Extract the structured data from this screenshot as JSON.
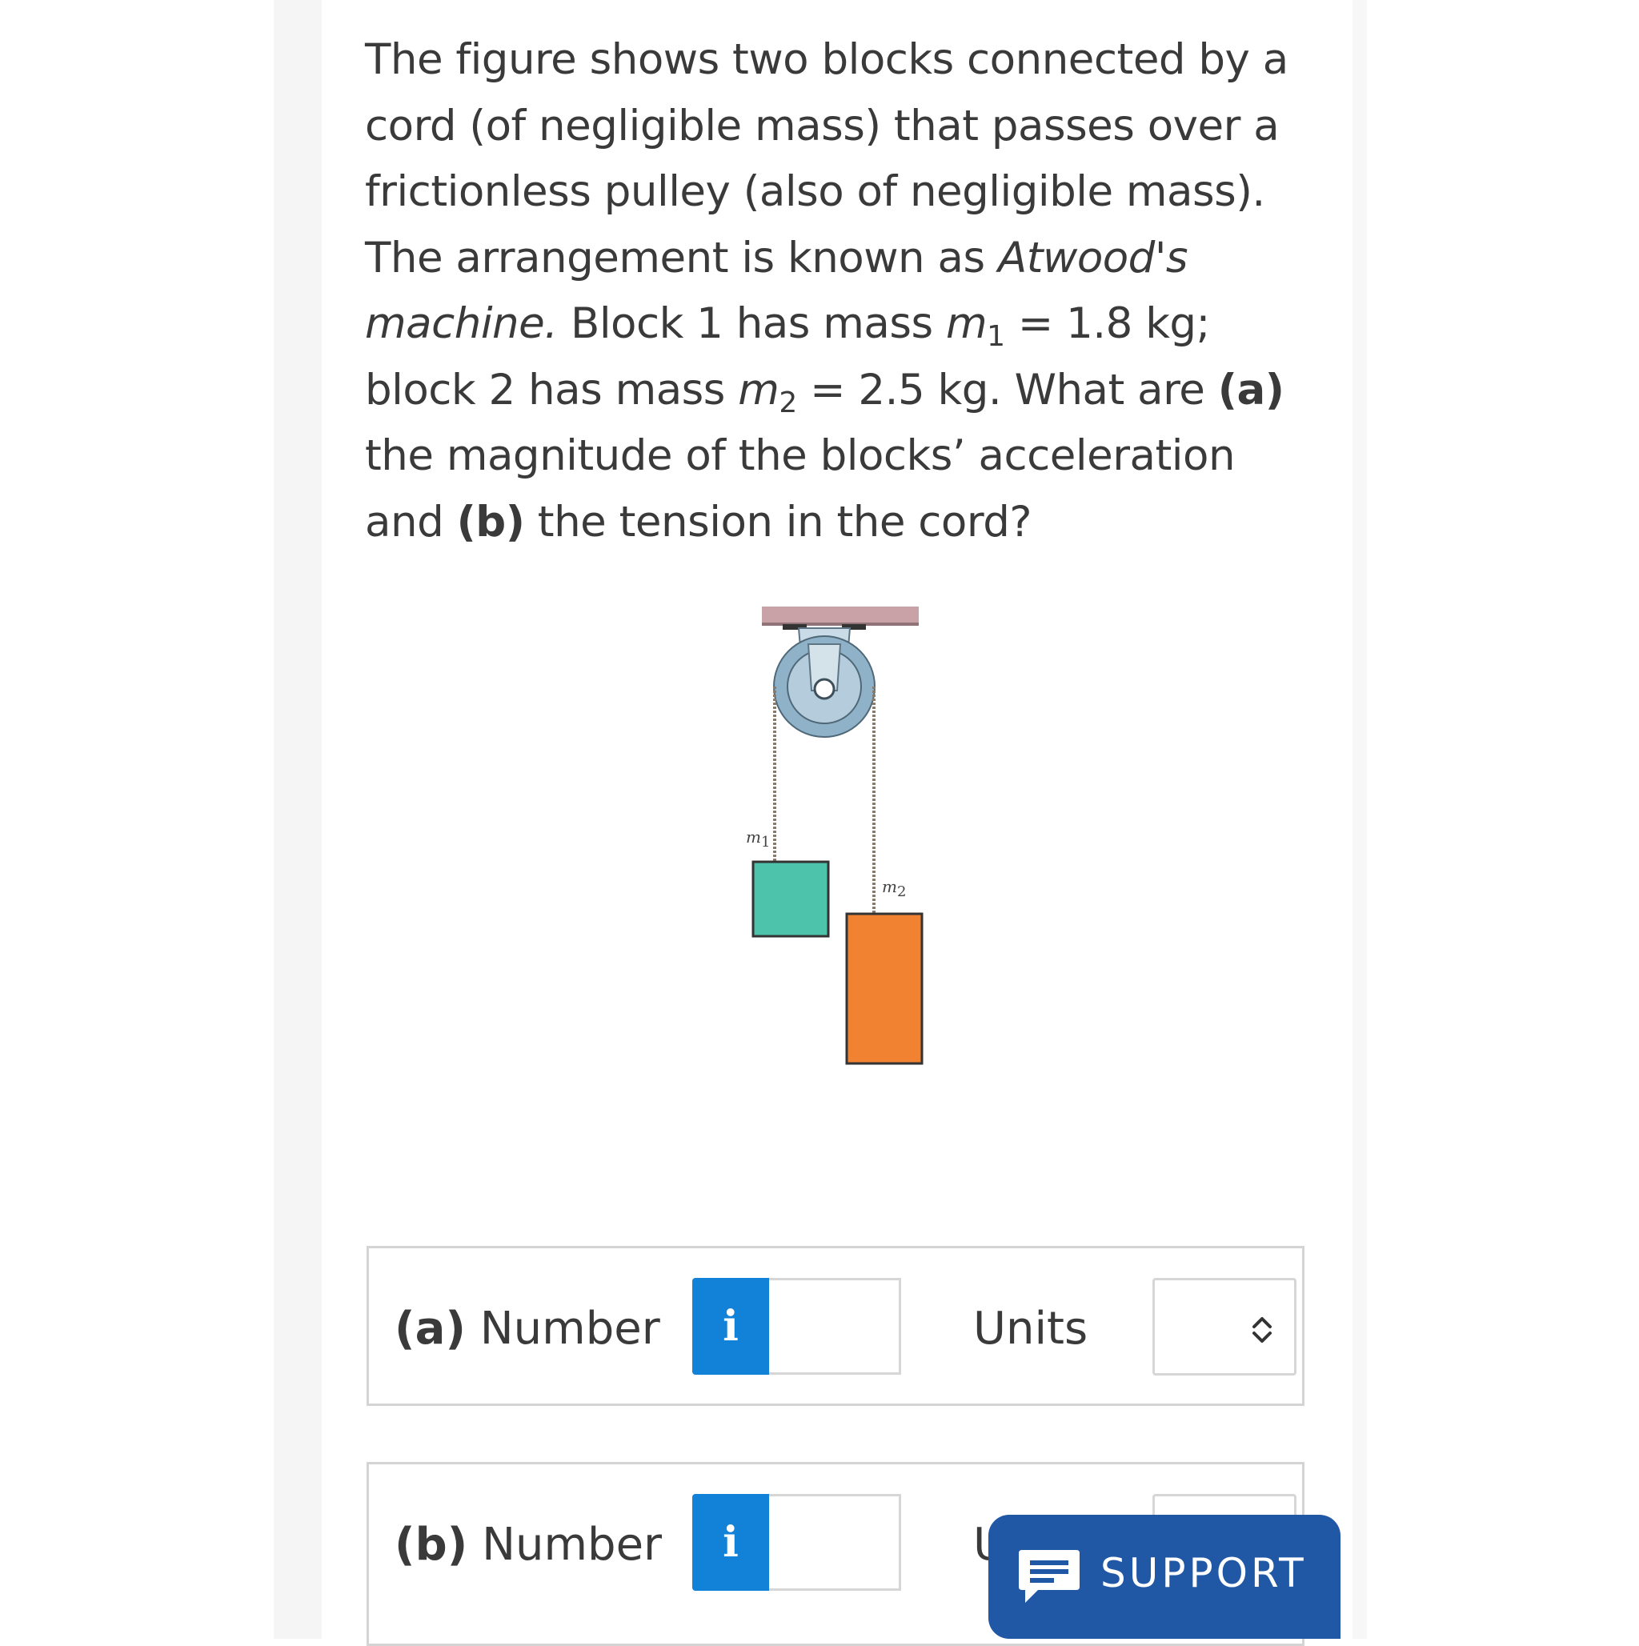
{
  "question": {
    "p1": "The figure shows two blocks connected by a cord (of negligible mass) that passes over a frictionless pulley (also of negligible mass). The arrangement is known as ",
    "machine_name": "Atwood's machine.",
    "p2": " Block 1 has mass ",
    "m1_symbol": "m",
    "m1_sub": "1",
    "p3": " = 1.8 kg; block 2 has mass ",
    "m2_symbol": "m",
    "m2_sub": "2",
    "p4": " = 2.5 kg. What are ",
    "part_a": "(a)",
    "p5": " the magnitude of the blocks’ acceleration and ",
    "part_b": "(b)",
    "p6": " the tension in the cord?"
  },
  "figure": {
    "label_m1": "m",
    "label_m1_sub": "1",
    "label_m2": "m",
    "label_m2_sub": "2",
    "colors": {
      "ceiling": "#c9a2a8",
      "pulley": "#8fb2c8",
      "block1": "#4ec3ac",
      "block2": "#f08232"
    }
  },
  "answers": [
    {
      "part": "(a)",
      "label": " Number",
      "info": "i",
      "value": "",
      "units_label": "Units",
      "units_value": ""
    },
    {
      "part": "(b)",
      "label": " Number",
      "info": "i",
      "value": "",
      "units_label": "U",
      "units_value": ""
    }
  ],
  "support": {
    "label": "SUPPORT",
    "icon": "chat-icon",
    "color": "#2158a6"
  },
  "colors": {
    "info_button": "#1282d9",
    "text": "#3a3a3a",
    "border": "#d4d4d4"
  }
}
